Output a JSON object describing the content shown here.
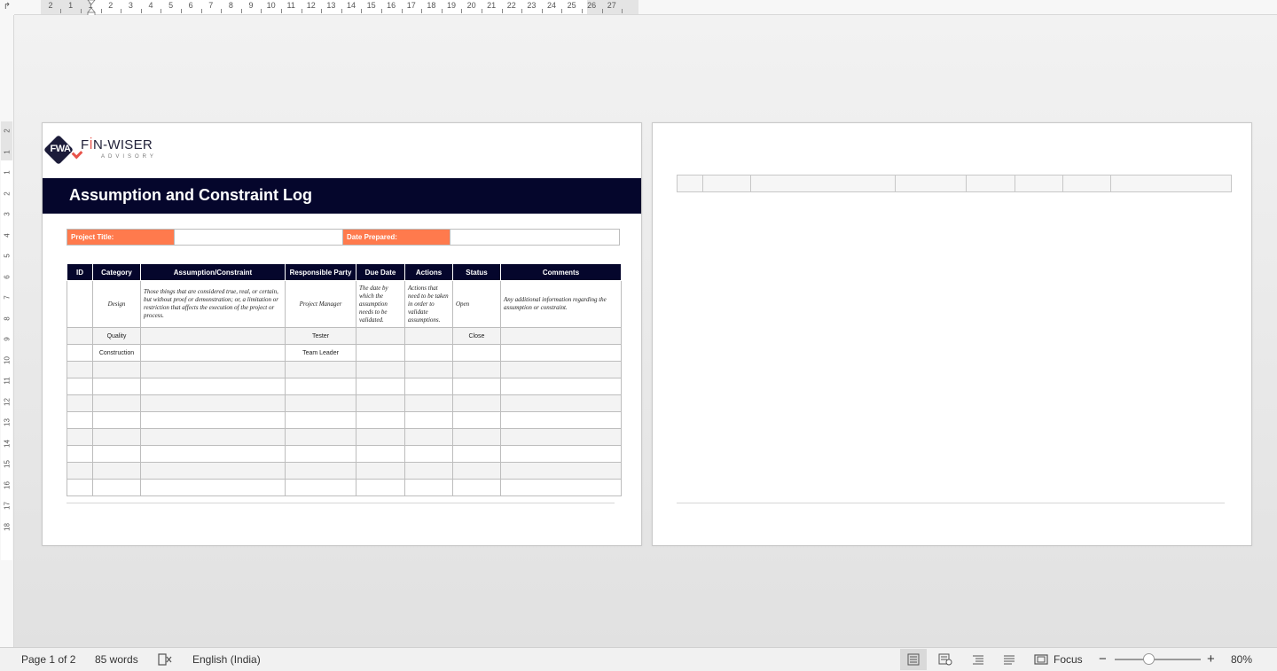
{
  "ruler": {
    "corner": "↱",
    "numbers": [
      "2",
      "1",
      "1",
      "2",
      "3",
      "4",
      "5",
      "6",
      "7",
      "8",
      "9",
      "10",
      "11",
      "12",
      "13",
      "14",
      "15",
      "16",
      "17",
      "18",
      "19",
      "20",
      "21",
      "22",
      "23",
      "24",
      "25",
      "26",
      "27"
    ],
    "vnumbers": [
      "2",
      "1",
      "1",
      "2",
      "3",
      "4",
      "5",
      "6",
      "7",
      "8",
      "9",
      "10",
      "11",
      "12",
      "13",
      "14",
      "15",
      "16",
      "17",
      "18"
    ]
  },
  "logo": {
    "initials": "FWA",
    "brand_a": "F",
    "brand_dot": "İ",
    "brand_b": "N-WISER",
    "tagline": "ADVISORY"
  },
  "doc": {
    "title": "Assumption and Constraint Log",
    "project_title_label": "Project Title:",
    "date_prepared_label": "Date Prepared:"
  },
  "table": {
    "headers": [
      "ID",
      "Category",
      "Assumption/Constraint",
      "Responsible Party",
      "Due Date",
      "Actions",
      "Status",
      "Comments"
    ],
    "rows": [
      {
        "id": "",
        "category": "Design",
        "assumption": "Those things that are considered true, real, or certain, but without proof or demonstration; or, a limitation or restriction that affects the execution of the project or process.",
        "party": "Project Manager",
        "due": "The date by which the assumption needs to be validated.",
        "actions": "Actions that need to be taken in order to validate assumptions.",
        "status": "Open",
        "comments": "Any additional information regarding the assumption or constraint."
      },
      {
        "id": "",
        "category": "Quality",
        "assumption": "",
        "party": "Tester",
        "due": "",
        "actions": "",
        "status": "Close",
        "comments": ""
      },
      {
        "id": "",
        "category": "Construction",
        "assumption": "",
        "party": "Team Leader",
        "due": "",
        "actions": "",
        "status": "",
        "comments": ""
      }
    ]
  },
  "statusbar": {
    "page": "Page 1 of 2",
    "words": "85 words",
    "language": "English (India)",
    "focus": "Focus",
    "zoom": "80%",
    "minus": "−",
    "plus": "+"
  },
  "colors": {
    "title_bar": "#05062c",
    "label_orange": "#ff7a4d",
    "logo_red": "#e8534a"
  }
}
